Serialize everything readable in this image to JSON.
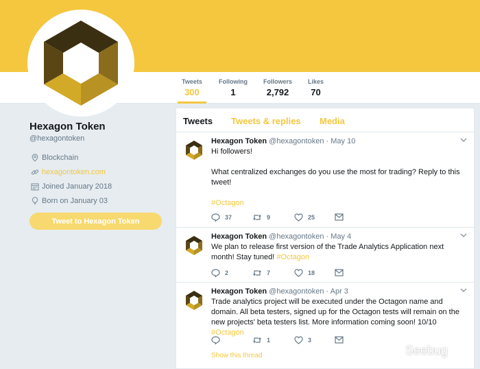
{
  "colors": {
    "accent": "#f4c73e",
    "banner": "#f4c73e",
    "text": "#14171a",
    "muted": "#657786"
  },
  "stats": [
    {
      "label": "Tweets",
      "value": "300"
    },
    {
      "label": "Following",
      "value": "1"
    },
    {
      "label": "Followers",
      "value": "2,792"
    },
    {
      "label": "Likes",
      "value": "70"
    }
  ],
  "profile": {
    "name": "Hexagon Token",
    "handle": "@hexagontoken",
    "location": "Blockchain",
    "website": "hexagontoken.com",
    "joined": "Joined January 2018",
    "born": "Born on January 03",
    "tweet_to_label": "Tweet to Hexagon Token"
  },
  "tabs": [
    "Tweets",
    "Tweets & replies",
    "Media"
  ],
  "tweets": [
    {
      "name": "Hexagon Token",
      "handle": "@hexagontoken",
      "date": "· May 10",
      "line1": "Hi followers!",
      "line2": "What centralized exchanges do you use the most for trading? Reply to this tweet!",
      "tag": "#Octagon",
      "replies": "37",
      "retweets": "9",
      "likes": "25"
    },
    {
      "name": "Hexagon Token",
      "handle": "@hexagontoken",
      "date": "· May 4",
      "text": "We plan to release first version of the Trade Analytics Application next month! Stay tuned! ",
      "tag": "#Octagon",
      "replies": "2",
      "retweets": "7",
      "likes": "18"
    },
    {
      "name": "Hexagon Token",
      "handle": "@hexagontoken",
      "date": "· Apr 3",
      "text": "Trade analytics project will be executed under the Octagon name and domain. All beta testers, signed up for the Octagon tests will remain on the new projects' beta testers list. More information coming soon! 10/10 ",
      "tag": "#Octagon",
      "replies": "",
      "retweets": "1",
      "likes": "3",
      "show_thread": "Show this thread"
    }
  ],
  "icons": {
    "location": "location-pin-icon",
    "link": "link-icon",
    "calendar": "calendar-icon",
    "birthday": "balloon-icon",
    "reply": "reply-icon",
    "retweet": "retweet-icon",
    "like": "heart-icon",
    "dm": "envelope-icon",
    "menu": "chevron-down-icon"
  },
  "watermark": "Seebug"
}
